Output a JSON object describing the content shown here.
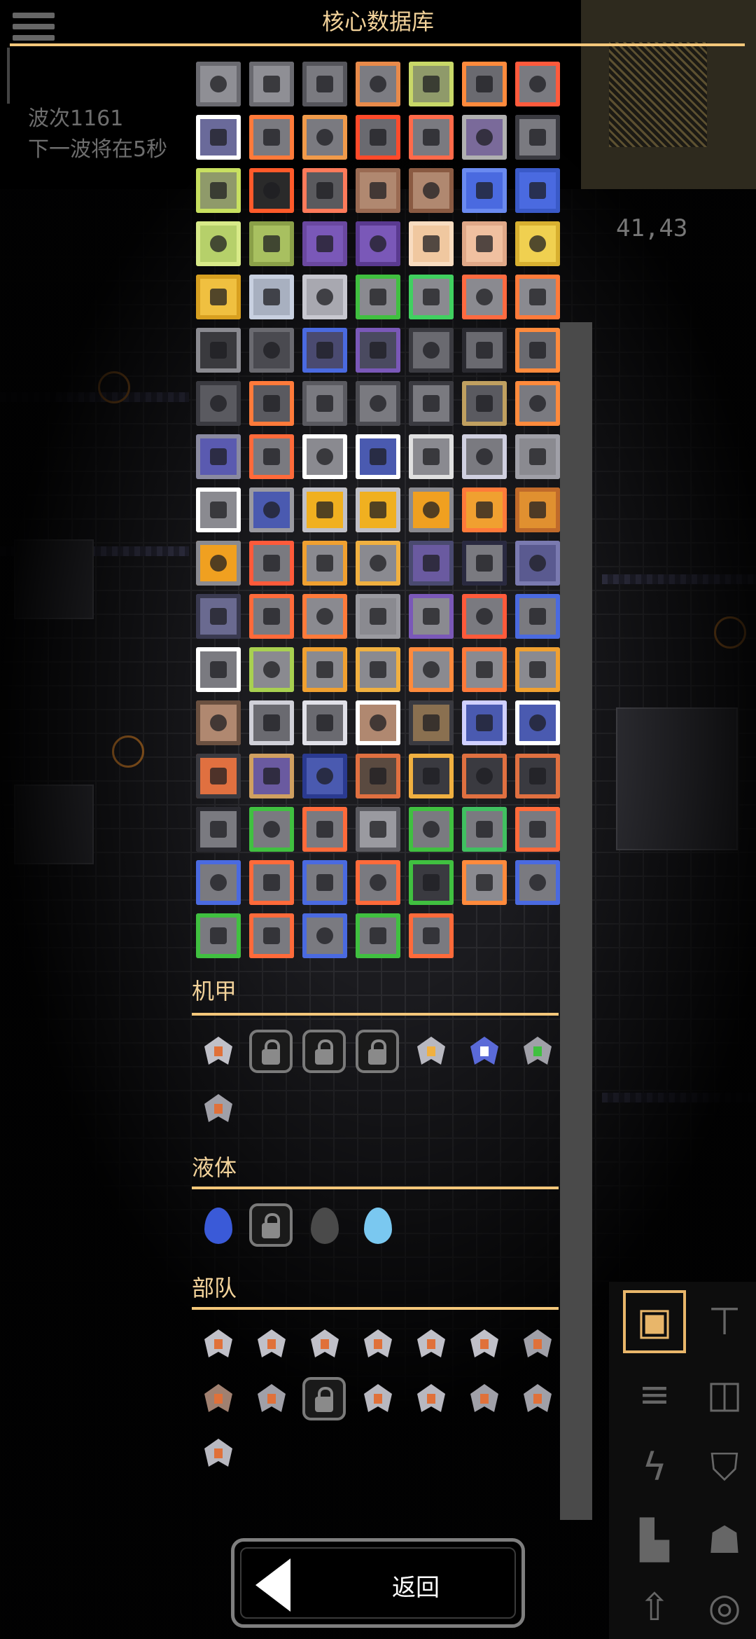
{
  "title": "核心数据库",
  "hud": {
    "wave_line1": "波次1161",
    "wave_line2": "下一波将在5秒",
    "coords": "41,43"
  },
  "colors": {
    "accent": "#f4c77a",
    "title_text": "#f2d29a",
    "scrollbar": "#4a4a4a"
  },
  "blocks": {
    "columns": 7,
    "items": [
      {
        "bg": "#8f8f95",
        "ring": "#6a6a70"
      },
      {
        "bg": "#8f8f95",
        "ring": "#6a6a70"
      },
      {
        "bg": "#7a7a80",
        "ring": "#55555b"
      },
      {
        "bg": "#7c7c82",
        "ring": "#e88a4a"
      },
      {
        "bg": "#8f9a6a",
        "ring": "#c8d868"
      },
      {
        "bg": "#6a6a70",
        "ring": "#ff8a3c"
      },
      {
        "bg": "#7a7a80",
        "ring": "#ff5a3c"
      },
      {
        "bg": "#6a6a9a",
        "ring": "#ffffff"
      },
      {
        "bg": "#7a7a80",
        "ring": "#ff7a3a"
      },
      {
        "bg": "#7a7a80",
        "ring": "#f09a4a"
      },
      {
        "bg": "#6a6a70",
        "ring": "#ff4a2a"
      },
      {
        "bg": "#7a7a80",
        "ring": "#ff6a4a"
      },
      {
        "bg": "#7a6a9a",
        "ring": "#b0b0b0"
      },
      {
        "bg": "#7a7a80",
        "ring": "#3a3a40"
      },
      {
        "bg": "#8f9a6a",
        "ring": "#c8e060"
      },
      {
        "bg": "#2a2a2a",
        "ring": "#ff5a2a"
      },
      {
        "bg": "#5a5a5e",
        "ring": "#ff7a5a"
      },
      {
        "bg": "#b08870",
        "ring": "#9a6a52"
      },
      {
        "bg": "#b08870",
        "ring": "#8a5a42"
      },
      {
        "bg": "#4a6ae0",
        "ring": "#6a8af0"
      },
      {
        "bg": "#4a6ae0",
        "ring": "#3a5ac8"
      },
      {
        "bg": "#b6d06a",
        "ring": "#d8ea88"
      },
      {
        "bg": "#a8c060",
        "ring": "#8aa048"
      },
      {
        "bg": "#7a58b8",
        "ring": "#6a48a0"
      },
      {
        "bg": "#7a58b8",
        "ring": "#5a3a90"
      },
      {
        "bg": "#f0c8a0",
        "ring": "#f8dcc0"
      },
      {
        "bg": "#f0c0a0",
        "ring": "#e0a888"
      },
      {
        "bg": "#f0d050",
        "ring": "#d8b030"
      },
      {
        "bg": "#f0c040",
        "ring": "#d8a020"
      },
      {
        "bg": "#a8b0c0",
        "ring": "#c8d0e0"
      },
      {
        "bg": "#a8a8b0",
        "ring": "#c8c8d0"
      },
      {
        "bg": "#8a8a90",
        "ring": "#40c040"
      },
      {
        "bg": "#8a8a90",
        "ring": "#40d060"
      },
      {
        "bg": "#8a8a90",
        "ring": "#ff6a40"
      },
      {
        "bg": "#8a8a90",
        "ring": "#ff7a3a"
      },
      {
        "bg": "#3a3a3e",
        "ring": "#8a8a90"
      },
      {
        "bg": "#4a4a50",
        "ring": "#6a6a70"
      },
      {
        "bg": "#4a4a70",
        "ring": "#4a6ae0"
      },
      {
        "bg": "#4a4a60",
        "ring": "#7a58b8"
      },
      {
        "bg": "#6a6a70",
        "ring": "#3a3a40"
      },
      {
        "bg": "#6a6a70",
        "ring": "#2a2a30"
      },
      {
        "bg": "#6a6a70",
        "ring": "#ff8a3c"
      },
      {
        "bg": "#5a5a60",
        "ring": "#3a3a40"
      },
      {
        "bg": "#5a5a60",
        "ring": "#ff7a3a"
      },
      {
        "bg": "#7a7a80",
        "ring": "#5a5a60"
      },
      {
        "bg": "#7a7a80",
        "ring": "#4a4a50"
      },
      {
        "bg": "#7a7a80",
        "ring": "#3a3a40"
      },
      {
        "bg": "#5a5a60",
        "ring": "#c0a060"
      },
      {
        "bg": "#7a7a80",
        "ring": "#ff8a3c"
      },
      {
        "bg": "#5a5ab0",
        "ring": "#8a8aa0"
      },
      {
        "bg": "#7a7a80",
        "ring": "#ff6a3a"
      },
      {
        "bg": "#8a8a90",
        "ring": "#ffffff"
      },
      {
        "bg": "#4a5ab0",
        "ring": "#ffffff"
      },
      {
        "bg": "#8a8a90",
        "ring": "#e0e0e0"
      },
      {
        "bg": "#7a7a80",
        "ring": "#d0d0e0"
      },
      {
        "bg": "#8a8a90",
        "ring": "#a0a0a8"
      },
      {
        "bg": "#8a8a90",
        "ring": "#ffffff"
      },
      {
        "bg": "#4a5ab0",
        "ring": "#9a9aa0"
      },
      {
        "bg": "#f0b020",
        "ring": "#c0c0c8"
      },
      {
        "bg": "#f0b020",
        "ring": "#c0c0c8"
      },
      {
        "bg": "#f0a020",
        "ring": "#8a8a90"
      },
      {
        "bg": "#f0a030",
        "ring": "#ff7a3a"
      },
      {
        "bg": "#e09030",
        "ring": "#c06a2a"
      },
      {
        "bg": "#f0a020",
        "ring": "#8a8a90"
      },
      {
        "bg": "#7a7a80",
        "ring": "#ff5a3a"
      },
      {
        "bg": "#8a8a90",
        "ring": "#f0a030"
      },
      {
        "bg": "#8a8a90",
        "ring": "#f0b040"
      },
      {
        "bg": "#6a5aa0",
        "ring": "#4a4a70"
      },
      {
        "bg": "#7a7a80",
        "ring": "#2a2a40"
      },
      {
        "bg": "#5a5a90",
        "ring": "#7a7ab0"
      },
      {
        "bg": "#6a6a90",
        "ring": "#3a3a50"
      },
      {
        "bg": "#7a7a80",
        "ring": "#ff6a3a"
      },
      {
        "bg": "#8a8a90",
        "ring": "#ff7a3a"
      },
      {
        "bg": "#8a8a90",
        "ring": "#9a9aa0"
      },
      {
        "bg": "#8a8a90",
        "ring": "#7a58b8"
      },
      {
        "bg": "#7a7a80",
        "ring": "#ff5a3a"
      },
      {
        "bg": "#7a7a80",
        "ring": "#4a6ae0"
      },
      {
        "bg": "#7a7a80",
        "ring": "#ffffff"
      },
      {
        "bg": "#8a8a90",
        "ring": "#a8d050"
      },
      {
        "bg": "#8a8a90",
        "ring": "#f0a030"
      },
      {
        "bg": "#8a8a90",
        "ring": "#f0b040"
      },
      {
        "bg": "#8a8a90",
        "ring": "#ff8a3c"
      },
      {
        "bg": "#8a8a90",
        "ring": "#ff7a3a"
      },
      {
        "bg": "#8a8a90",
        "ring": "#f0a030"
      },
      {
        "bg": "#b08870",
        "ring": "#6a5040"
      },
      {
        "bg": "#6a6a70",
        "ring": "#d0d0d8"
      },
      {
        "bg": "#6a6a70",
        "ring": "#e0e0e8"
      },
      {
        "bg": "#b08870",
        "ring": "#ffffff"
      },
      {
        "bg": "#8a7050",
        "ring": "#3a3a40"
      },
      {
        "bg": "#4a5ab0",
        "ring": "#d0d0ff"
      },
      {
        "bg": "#4a5ab0",
        "ring": "#ffffff"
      },
      {
        "bg": "#e07040",
        "ring": "#3a3a40"
      },
      {
        "bg": "#6a5aa0",
        "ring": "#d0a060"
      },
      {
        "bg": "#4a5ab0",
        "ring": "#2a3a90"
      },
      {
        "bg": "#5a4a40",
        "ring": "#e07040"
      },
      {
        "bg": "#3a3a40",
        "ring": "#f0b040"
      },
      {
        "bg": "#3a3a40",
        "ring": "#e07040"
      },
      {
        "bg": "#3a3a40",
        "ring": "#e07040"
      },
      {
        "bg": "#7a7a80",
        "ring": "#2a2a30"
      },
      {
        "bg": "#7a7a80",
        "ring": "#40c040"
      },
      {
        "bg": "#7a7a80",
        "ring": "#ff6a3a"
      },
      {
        "bg": "#9a9aa0",
        "ring": "#5a5a60"
      },
      {
        "bg": "#7a7a80",
        "ring": "#40c040"
      },
      {
        "bg": "#7a7a80",
        "ring": "#40c060"
      },
      {
        "bg": "#7a7a80",
        "ring": "#ff6a3a"
      },
      {
        "bg": "#7a7a80",
        "ring": "#4a6ae0"
      },
      {
        "bg": "#7a7a80",
        "ring": "#ff6a3a"
      },
      {
        "bg": "#7a7a80",
        "ring": "#4a6ae0"
      },
      {
        "bg": "#7a7a80",
        "ring": "#ff6a3a"
      },
      {
        "bg": "#3a3a40",
        "ring": "#40c040"
      },
      {
        "bg": "#8a8a90",
        "ring": "#ff8a3c"
      },
      {
        "bg": "#7a7a80",
        "ring": "#4a6ae0"
      },
      {
        "bg": "#7a7a80",
        "ring": "#40c040"
      },
      {
        "bg": "#7a7a80",
        "ring": "#ff6a3a"
      },
      {
        "bg": "#7a7a80",
        "ring": "#4a6ae0"
      },
      {
        "bg": "#7a7a80",
        "ring": "#40c040"
      },
      {
        "bg": "#7a7a80",
        "ring": "#ff6a3a"
      }
    ]
  },
  "mechs": {
    "label": "机甲",
    "items": [
      {
        "locked": false,
        "body": "#c0c0c8",
        "core": "#e0713a"
      },
      {
        "locked": true
      },
      {
        "locked": true
      },
      {
        "locked": true
      },
      {
        "locked": false,
        "body": "#b8b8c0",
        "core": "#f0b040"
      },
      {
        "locked": false,
        "body": "#5a6ad8",
        "core": "#ffffff"
      },
      {
        "locked": false,
        "body": "#a0a0a8",
        "core": "#40c040"
      },
      {
        "locked": false,
        "body": "#a0a0a8",
        "core": "#e0713a"
      }
    ]
  },
  "liquids": {
    "label": "液体",
    "items": [
      {
        "locked": false,
        "color": "#3a5ad8"
      },
      {
        "locked": true
      },
      {
        "locked": false,
        "color": "#4a4a4a"
      },
      {
        "locked": false,
        "color": "#7ac8f0"
      }
    ]
  },
  "units": {
    "label": "部队",
    "items": [
      {
        "locked": false,
        "body": "#c0c0c8",
        "core": "#e0713a"
      },
      {
        "locked": false,
        "body": "#c0c0c8",
        "core": "#e0713a"
      },
      {
        "locked": false,
        "body": "#c0c0c8",
        "core": "#e0713a"
      },
      {
        "locked": false,
        "body": "#c0c0c8",
        "core": "#e0713a"
      },
      {
        "locked": false,
        "body": "#c0c0c8",
        "core": "#e0713a"
      },
      {
        "locked": false,
        "body": "#c0c0c8",
        "core": "#e0713a"
      },
      {
        "locked": false,
        "body": "#a0a0a8",
        "core": "#e0713a"
      },
      {
        "locked": false,
        "body": "#a08070",
        "core": "#e0713a"
      },
      {
        "locked": false,
        "body": "#a0a0a8",
        "core": "#e0713a"
      },
      {
        "locked": true
      },
      {
        "locked": false,
        "body": "#b8b8c0",
        "core": "#e0713a"
      },
      {
        "locked": false,
        "body": "#b8b8c0",
        "core": "#e0713a"
      },
      {
        "locked": false,
        "body": "#a0a0a8",
        "core": "#e0713a"
      },
      {
        "locked": false,
        "body": "#a0a0a8",
        "core": "#e0713a"
      },
      {
        "locked": false,
        "body": "#b8b8c0",
        "core": "#e0713a"
      }
    ]
  },
  "back_button": {
    "label": "返回",
    "icon": "back-arrow-icon"
  },
  "build_panel": {
    "icons": [
      "turret-icon",
      "distribution-icon",
      "crafting-icon",
      "liquid-icon",
      "power-icon",
      "defense-icon",
      "factory-icon",
      "units-icon",
      "upgrade-icon",
      "effect-icon"
    ]
  }
}
